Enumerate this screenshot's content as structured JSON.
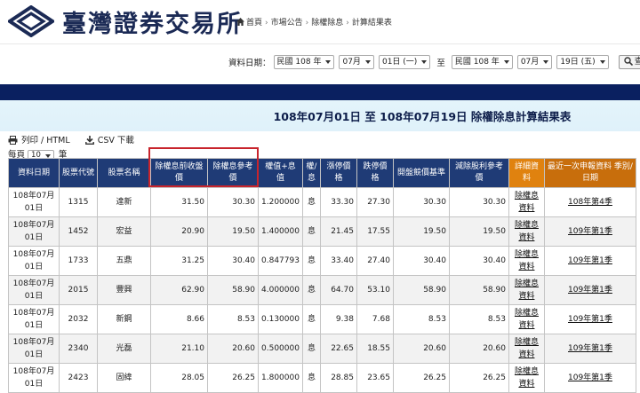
{
  "header": {
    "logo_text": "臺灣證券交易所",
    "breadcrumb": [
      "首頁",
      "市場公告",
      "除權除息",
      "計算結果表"
    ]
  },
  "query": {
    "label": "資料日期：",
    "start_year": "民國 108 年",
    "start_month": "07月",
    "start_day": "01日 (一)",
    "to": "至",
    "end_year": "民國 108 年",
    "end_month": "07月",
    "end_day": "19日 (五)",
    "button": "查詢"
  },
  "report_title": "108年07月01日 至 108年07月19日 除權除息計算結果表",
  "tools": {
    "print": "列印 / HTML",
    "csv": "CSV 下載"
  },
  "pagesize": {
    "prefix": "每頁",
    "value": "10",
    "suffix": "筆"
  },
  "columns": [
    "資料日期",
    "股票代號",
    "股票名稱",
    "除權息前收盤價",
    "除權息參考價",
    "權值+息值",
    "權/息",
    "漲停價格",
    "跌停價格",
    "開盤競價基準",
    "減除股利參考價",
    "詳細資料",
    "最近一次申報資料 季別/日期"
  ],
  "rows": [
    {
      "date": "108年07月01日",
      "code": "1315",
      "name": "達新",
      "close": "31.50",
      "ref": "30.30",
      "value": "1.200000",
      "type": "息",
      "up": "33.30",
      "down": "27.30",
      "open": "30.30",
      "div": "30.30",
      "detail": "除權息資料",
      "report": "108年第4季"
    },
    {
      "date": "108年07月01日",
      "code": "1452",
      "name": "宏益",
      "close": "20.90",
      "ref": "19.50",
      "value": "1.400000",
      "type": "息",
      "up": "21.45",
      "down": "17.55",
      "open": "19.50",
      "div": "19.50",
      "detail": "除權息資料",
      "report": "109年第1季"
    },
    {
      "date": "108年07月01日",
      "code": "1733",
      "name": "五鼎",
      "close": "31.25",
      "ref": "30.40",
      "value": "0.847793",
      "type": "息",
      "up": "33.40",
      "down": "27.40",
      "open": "30.40",
      "div": "30.40",
      "detail": "除權息資料",
      "report": "109年第1季"
    },
    {
      "date": "108年07月01日",
      "code": "2015",
      "name": "豐興",
      "close": "62.90",
      "ref": "58.90",
      "value": "4.000000",
      "type": "息",
      "up": "64.70",
      "down": "53.10",
      "open": "58.90",
      "div": "58.90",
      "detail": "除權息資料",
      "report": "109年第1季"
    },
    {
      "date": "108年07月01日",
      "code": "2032",
      "name": "新鋼",
      "close": "8.66",
      "ref": "8.53",
      "value": "0.130000",
      "type": "息",
      "up": "9.38",
      "down": "7.68",
      "open": "8.53",
      "div": "8.53",
      "detail": "除權息資料",
      "report": "109年第1季"
    },
    {
      "date": "108年07月01日",
      "code": "2340",
      "name": "光磊",
      "close": "21.10",
      "ref": "20.60",
      "value": "0.500000",
      "type": "息",
      "up": "22.65",
      "down": "18.55",
      "open": "20.60",
      "div": "20.60",
      "detail": "除權息資料",
      "report": "109年第1季"
    },
    {
      "date": "108年07月01日",
      "code": "2423",
      "name": "固緯",
      "close": "28.05",
      "ref": "26.25",
      "value": "1.800000",
      "type": "息",
      "up": "28.85",
      "down": "23.65",
      "open": "26.25",
      "div": "26.25",
      "detail": "除權息資料",
      "report": "109年第1季"
    }
  ],
  "colors": {
    "navy": "#0a2060",
    "header_blue": "#1f3b76",
    "header_orange": "#e0820f",
    "highlight": "#c8242c"
  }
}
